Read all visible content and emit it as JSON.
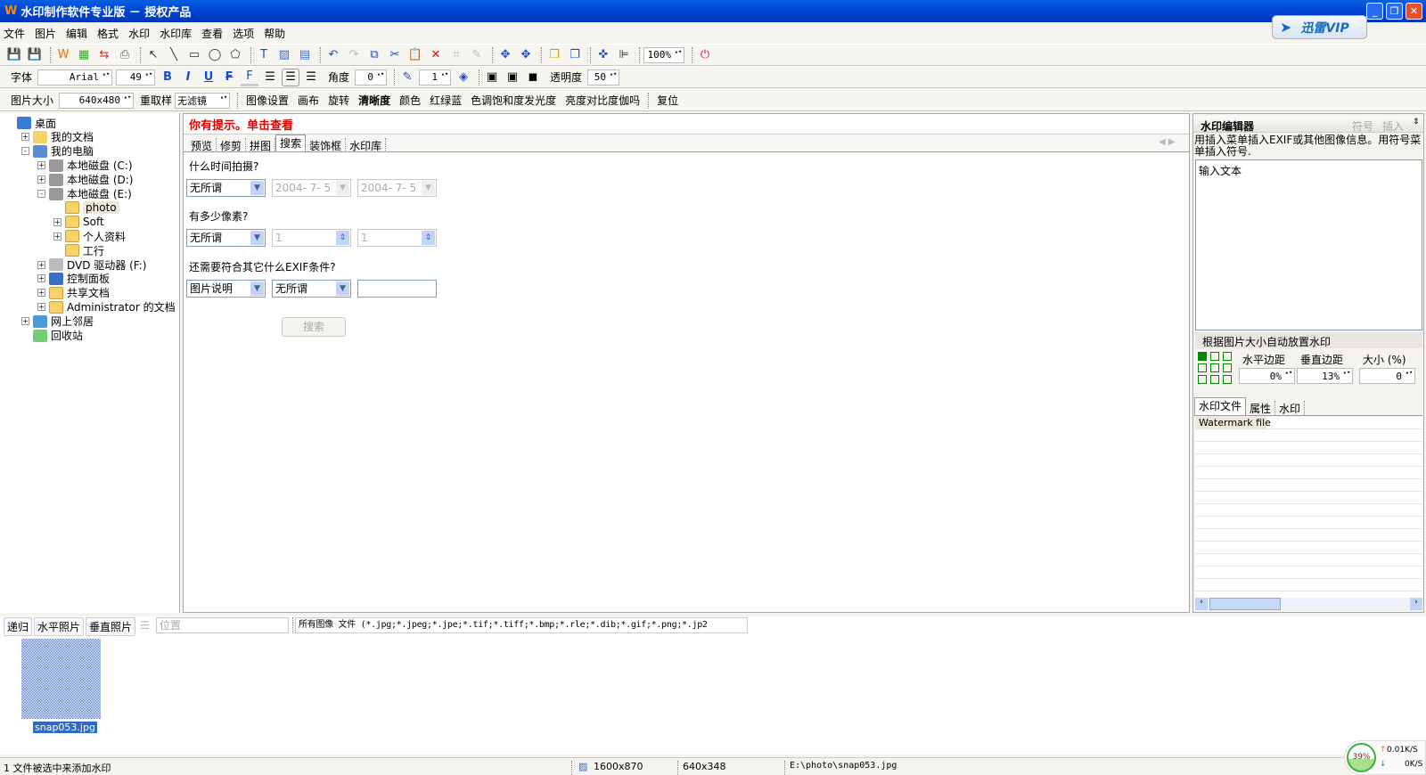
{
  "window": {
    "logo": "W",
    "title": "水印制作软件专业版 － 授权产品",
    "controls": [
      "minimize",
      "restore",
      "close"
    ]
  },
  "menu": [
    "文件",
    "图片",
    "编辑",
    "格式",
    "水印",
    "水印库",
    "查看",
    "选项",
    "帮助"
  ],
  "vip_label": "迅雷VIP",
  "toolbar1": {
    "icons": [
      "save-icon",
      "save-as-icon",
      "watermark-icon",
      "batch-icon",
      "convert-icon",
      "print-icon",
      "pointer-icon",
      "line-icon",
      "rectangle-icon",
      "ellipse-icon",
      "polygon-icon",
      "text-icon",
      "image-icon",
      "exif-icon",
      "undo-icon",
      "redo-icon",
      "copy-icon",
      "cut-icon",
      "paste-icon",
      "delete-icon",
      "crop-icon",
      "brush-icon",
      "move-up-icon",
      "move-down-icon",
      "bring-front-icon",
      "send-back-icon",
      "center-icon",
      "align-icon"
    ],
    "zoom": "100%"
  },
  "toolbar2": {
    "font_label": "字体",
    "font": "Arial",
    "size": "49",
    "angle_label": "角度",
    "angle": "0",
    "stroke": "1",
    "opacity_label": "透明度",
    "opacity": "50"
  },
  "toolbar3": {
    "size_label": "图片大小",
    "size": "640x480",
    "resample_label": "重取样",
    "filter": "无滤镜",
    "items": [
      "图像设置",
      "画布",
      "旋转",
      "清晰度",
      "颜色",
      "红绿蓝",
      "色调饱和度发光度",
      "亮度对比度伽吗",
      "复位"
    ]
  },
  "tree": [
    {
      "label": "桌面",
      "level": 0,
      "expander": "",
      "icon": "desktop"
    },
    {
      "label": "我的文档",
      "level": 1,
      "expander": "+",
      "icon": "documents"
    },
    {
      "label": "我的电脑",
      "level": 1,
      "expander": "-",
      "icon": "computer"
    },
    {
      "label": "本地磁盘 (C:)",
      "level": 2,
      "expander": "+",
      "icon": "drive"
    },
    {
      "label": "本地磁盘 (D:)",
      "level": 2,
      "expander": "+",
      "icon": "drive"
    },
    {
      "label": "本地磁盘 (E:)",
      "level": 2,
      "expander": "-",
      "icon": "drive"
    },
    {
      "label": "photo",
      "level": 3,
      "expander": "",
      "icon": "folder",
      "selected": true
    },
    {
      "label": "Soft",
      "level": 3,
      "expander": "+",
      "icon": "folder"
    },
    {
      "label": "个人资料",
      "level": 3,
      "expander": "+",
      "icon": "folder"
    },
    {
      "label": "工行",
      "level": 3,
      "expander": "",
      "icon": "folder"
    },
    {
      "label": "DVD 驱动器 (F:)",
      "level": 2,
      "expander": "+",
      "icon": "dvd"
    },
    {
      "label": "控制面板",
      "level": 2,
      "expander": "+",
      "icon": "control-panel"
    },
    {
      "label": "共享文档",
      "level": 2,
      "expander": "+",
      "icon": "folder"
    },
    {
      "label": "Administrator 的文档",
      "level": 2,
      "expander": "+",
      "icon": "folder"
    },
    {
      "label": "网上邻居",
      "level": 1,
      "expander": "+",
      "icon": "network"
    },
    {
      "label": "回收站",
      "level": 1,
      "expander": "",
      "icon": "recycle-bin"
    }
  ],
  "center": {
    "hint": "你有提示。单击查看",
    "tabs": [
      "预览",
      "修剪",
      "拼图",
      "搜索",
      "装饰框",
      "水印库"
    ],
    "active_tab": "搜索",
    "q1": "什么时间拍摄?",
    "q1_select": "无所谓",
    "date_from": "2004- 7- 5",
    "date_to": "2004- 7- 5",
    "q2": "有多少像素?",
    "q2_select": "无所谓",
    "px_min": "1",
    "px_max": "1",
    "q3": "还需要符合其它什么EXIF条件?",
    "q3_field": "图片说明",
    "q3_cond": "无所谓",
    "q3_value": "",
    "search_btn": "搜索"
  },
  "right": {
    "title": "水印编辑器",
    "symbol": "符号",
    "insert": "插入",
    "help": "用插入菜单插入EXIF或其他图像信息。用符号菜单插入符号.",
    "text": "输入文本",
    "auto_title": "根据图片大小自动放置水印",
    "h_label": "水平边距",
    "v_label": "垂直边距",
    "size_label": "大小 (%)",
    "h": "0%",
    "v": "13%",
    "size": "0",
    "tabs": [
      "水印文件",
      "属性",
      "水印"
    ],
    "list_header": "Watermark file"
  },
  "bottom": {
    "buttons": [
      "递归",
      "水平照片",
      "垂直照片"
    ],
    "position_placeholder": "位置",
    "filter": "所有图像 文件 (*.jpg;*.jpeg;*.jpe;*.tif;*.tiff;*.bmp;*.rle;*.dib;*.gif;*.png;*.jp2",
    "thumb": "snap053.jpg"
  },
  "status": {
    "msg": "1 文件被选中来添加水印",
    "screen": "1600x870",
    "image": "640x348",
    "path": "E:\\photo\\snap053.jpg",
    "net_pct": "39%",
    "up": "0.01K/S",
    "down": "0K/S"
  },
  "colors": {
    "title": "#0047d8",
    "hint": "#e00000",
    "selection": "#316ac5"
  }
}
